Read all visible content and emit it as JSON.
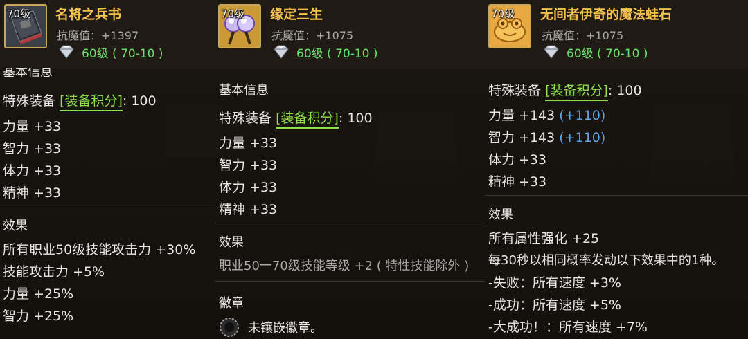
{
  "panel1": {
    "level_tag": "70级",
    "title": "名将之兵书",
    "resist": "抗魔值：+1397",
    "requirement": "60级 ( 70-10 )",
    "section_basic": "基本信息",
    "special_prefix": "特殊装备",
    "special_tag": "[装备积分]",
    "special_value": ": 100",
    "stats": [
      "力量 +33",
      "智力 +33",
      "体力 +33",
      "精神 +33"
    ],
    "section_effect": "效果",
    "effects": [
      "所有职业50级技能攻击力 +30%",
      "技能攻击力 +5%",
      "力量 +25%",
      "智力 +25%"
    ]
  },
  "panel2": {
    "level_tag": "70级",
    "title": "缘定三生",
    "resist": "抗魔值：+1075",
    "requirement": "60级 ( 70-10 )",
    "section_basic": "基本信息",
    "special_prefix": "特殊装备",
    "special_tag": "[装备积分]",
    "special_value": ": 100",
    "stats": [
      "力量 +33",
      "智力 +33",
      "体力 +33",
      "精神 +33"
    ],
    "section_effect": "效果",
    "effect_line": "职业50一70级技能等级 +2 ( 特性技能除外 )",
    "section_emblem": "徽章",
    "emblem_text": "未镶嵌徽章。"
  },
  "panel3": {
    "level_tag": "70级",
    "title": "无间者伊奇的魔法蛙石",
    "resist": "抗魔值：+1075",
    "requirement": "60级 ( 70-10 )",
    "special_prefix": "特殊装备",
    "special_tag": "[装备积分]",
    "special_value": ": 100",
    "stat_str": "力量 +143",
    "stat_str_bonus": "(+110)",
    "stat_int": "智力 +143",
    "stat_int_bonus": "(+110)",
    "stat_vit": "体力 +33",
    "stat_spr": "精神 +33",
    "section_effect": "效果",
    "effects": [
      "所有属性强化 +25",
      "每30秒以相同概率发动以下效果中的1种。",
      "-失败：所有速度 +3%",
      "-成功：所有速度 +5%",
      "-大成功！：所有速度 +7%"
    ]
  },
  "colors": {
    "title": "#f3c24e",
    "requirement": "#69e36c",
    "equip_tag": "#8fe24c",
    "bonus": "#5aa4ea"
  }
}
